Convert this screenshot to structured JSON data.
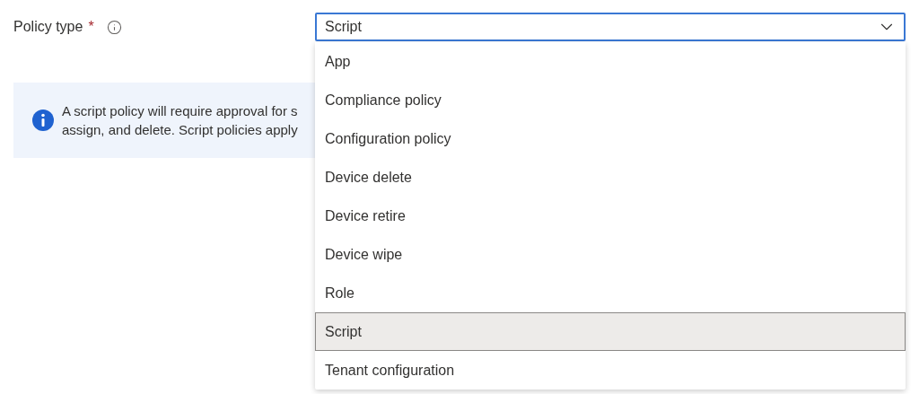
{
  "field": {
    "label": "Policy type",
    "required_mark": "*",
    "value": "Script",
    "expanded": true
  },
  "info_banner": {
    "lines": [
      "A script policy will require approval for s",
      "assign, and delete. Script policies apply"
    ]
  },
  "options": [
    {
      "label": "App",
      "selected": false
    },
    {
      "label": "Compliance policy",
      "selected": false
    },
    {
      "label": "Configuration policy",
      "selected": false
    },
    {
      "label": "Device delete",
      "selected": false
    },
    {
      "label": "Device retire",
      "selected": false
    },
    {
      "label": "Device wipe",
      "selected": false
    },
    {
      "label": "Role",
      "selected": false
    },
    {
      "label": "Script",
      "selected": true
    },
    {
      "label": "Tenant configuration",
      "selected": false
    }
  ]
}
